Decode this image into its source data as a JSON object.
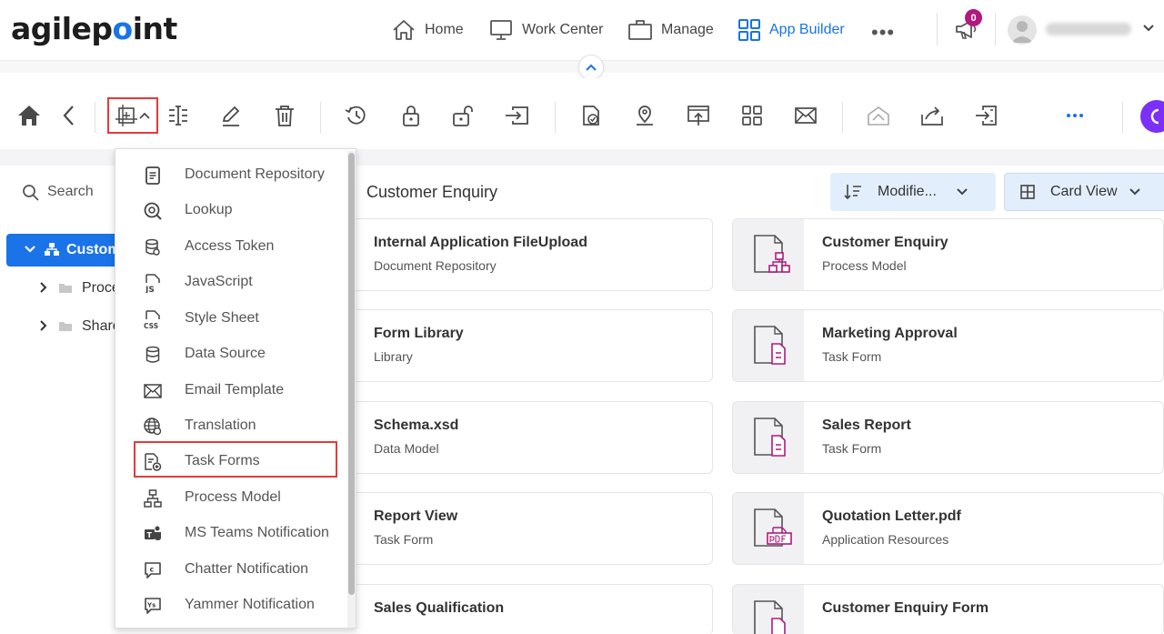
{
  "header": {
    "logo": {
      "before": "agilep",
      "dot": "o",
      "after": "int"
    },
    "nav": [
      {
        "label": "Home",
        "icon": "home-outline-icon"
      },
      {
        "label": "Work Center",
        "icon": "monitor-icon"
      },
      {
        "label": "Manage",
        "icon": "briefcase-icon"
      },
      {
        "label": "App Builder",
        "icon": "grid-icon",
        "active": true
      }
    ],
    "more": "•••",
    "notification_count": "0"
  },
  "toolbar": {
    "icons": [
      "home-icon",
      "back-icon",
      "new-icon",
      "chevron-up-icon",
      "rename-icon",
      "edit-icon",
      "delete-icon",
      "history-icon",
      "lock-icon",
      "unlock-icon",
      "import-icon",
      "check-in-icon",
      "location-icon",
      "publish-icon",
      "app-grid-icon",
      "email-icon",
      "undo-share-icon",
      "share-icon",
      "export-icon",
      "more-icon"
    ]
  },
  "left_panel": {
    "search_label": "Search",
    "tree": [
      {
        "label": "Custom",
        "selected": true
      },
      {
        "label": "Proce"
      },
      {
        "label": "Share"
      }
    ]
  },
  "main": {
    "title": "Customer Enquiry",
    "sort_label": "Modifie...",
    "view_label": "Card View",
    "cards_left": [
      {
        "title": "Internal Application FileUpload",
        "subtitle": "Document Repository"
      },
      {
        "title": "Form Library",
        "subtitle": "Library"
      },
      {
        "title": "Schema.xsd",
        "subtitle": "Data Model"
      },
      {
        "title": "Report View",
        "subtitle": "Task Form"
      },
      {
        "title": "Sales Qualification",
        "subtitle": ""
      }
    ],
    "cards_right": [
      {
        "title": "Customer Enquiry",
        "subtitle": "Process Model",
        "icon": "process-model-icon"
      },
      {
        "title": "Marketing Approval",
        "subtitle": "Task Form",
        "icon": "task-form-icon"
      },
      {
        "title": "Sales Report",
        "subtitle": "Task Form",
        "icon": "task-form-icon"
      },
      {
        "title": "Quotation Letter.pdf",
        "subtitle": "Application Resources",
        "icon": "pdf-icon"
      },
      {
        "title": "Customer Enquiry Form",
        "subtitle": "",
        "icon": "task-form-icon"
      }
    ]
  },
  "dropdown": {
    "items": [
      {
        "label": "Document Repository",
        "icon": "document-repository-icon"
      },
      {
        "label": "Lookup",
        "icon": "lookup-icon"
      },
      {
        "label": "Access Token",
        "icon": "access-token-icon"
      },
      {
        "label": "JavaScript",
        "icon": "javascript-icon"
      },
      {
        "label": "Style Sheet",
        "icon": "css-icon"
      },
      {
        "label": "Data Source",
        "icon": "data-source-icon"
      },
      {
        "label": "Email Template",
        "icon": "email-template-icon"
      },
      {
        "label": "Translation",
        "icon": "translation-icon"
      },
      {
        "label": "Task Forms",
        "icon": "task-forms-icon",
        "highlighted": true
      },
      {
        "label": "Process Model",
        "icon": "process-model-icon"
      },
      {
        "label": "MS Teams Notification",
        "icon": "ms-teams-icon"
      },
      {
        "label": "Chatter Notification",
        "icon": "chatter-icon"
      },
      {
        "label": "Yammer Notification",
        "icon": "yammer-icon"
      }
    ]
  },
  "colors": {
    "accent": "#1a73e8",
    "highlight_border": "#e33a3a",
    "resource_magenta": "#b0197e"
  }
}
